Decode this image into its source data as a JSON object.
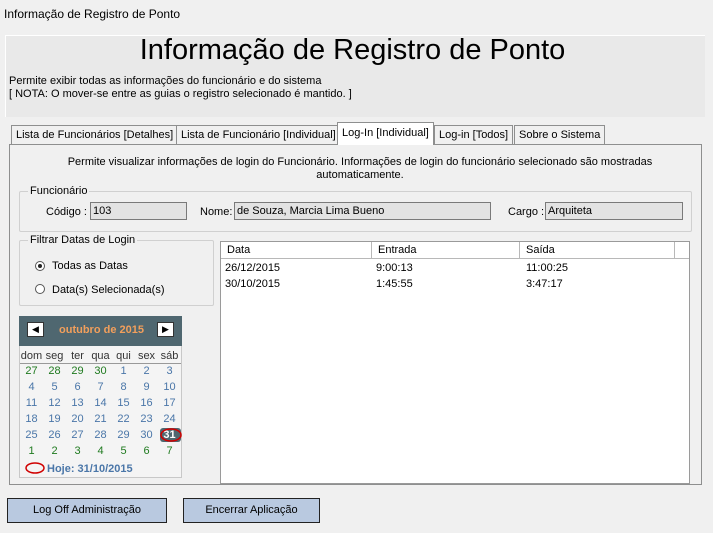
{
  "window": {
    "title": "Informação de Registro de Ponto"
  },
  "header": {
    "title": "Informação de Registro de Ponto",
    "description": "Permite exibir todas as informações do funcionário e do sistema",
    "note": "[ NOTA: O mover-se entre as guias o registro selecionado é mantido. ]"
  },
  "tabs": [
    {
      "label": "Lista de Funcionários [Detalhes]"
    },
    {
      "label": "Lista de Funcionário [Individual]"
    },
    {
      "label": "Log-In [Individual]",
      "active": true
    },
    {
      "label": "Log-in [Todos]"
    },
    {
      "label": "Sobre o Sistema"
    }
  ],
  "panel": {
    "description": "Permite visualizar informações de login do Funcionário. Informações de login do funcionário selecionado são mostradas automaticamente."
  },
  "funcionario": {
    "legend": "Funcionário",
    "codigo_label": "Código :",
    "codigo_value": "103",
    "nome_label": "Nome:",
    "nome_value": "de Souza, Marcia  Lima Bueno",
    "cargo_label": "Cargo :",
    "cargo_value": "Arquiteta"
  },
  "filter": {
    "legend": "Filtrar Datas de Login",
    "option_all": "Todas as Datas",
    "option_selected": "Data(s) Selecionada(s)",
    "selected": "all"
  },
  "calendar": {
    "month_label": "outubro de 2015",
    "prev_icon": "◀",
    "next_icon": "▶",
    "weekdays": [
      "dom",
      "seg",
      "ter",
      "qua",
      "qui",
      "sex",
      "sáb"
    ],
    "weeks": [
      [
        "27",
        "28",
        "29",
        "30",
        "1",
        "2",
        "3"
      ],
      [
        "4",
        "5",
        "6",
        "7",
        "8",
        "9",
        "10"
      ],
      [
        "11",
        "12",
        "13",
        "14",
        "15",
        "16",
        "17"
      ],
      [
        "18",
        "19",
        "20",
        "21",
        "22",
        "23",
        "24"
      ],
      [
        "25",
        "26",
        "27",
        "28",
        "29",
        "30",
        "31"
      ],
      [
        "1",
        "2",
        "3",
        "4",
        "5",
        "6",
        "7"
      ]
    ],
    "today_label": "Hoje: 31/10/2015",
    "accent_color": "#f29f5c",
    "header_color": "#4f6770"
  },
  "logins": {
    "columns": [
      "Data",
      "Entrada",
      "Saída"
    ],
    "rows": [
      [
        "26/12/2015",
        "9:00:13",
        "11:00:25"
      ],
      [
        "30/10/2015",
        "1:45:55",
        "3:47:17"
      ]
    ]
  },
  "buttons": {
    "logoff": "Log Off Administração",
    "exit": "Encerrar Aplicação"
  }
}
